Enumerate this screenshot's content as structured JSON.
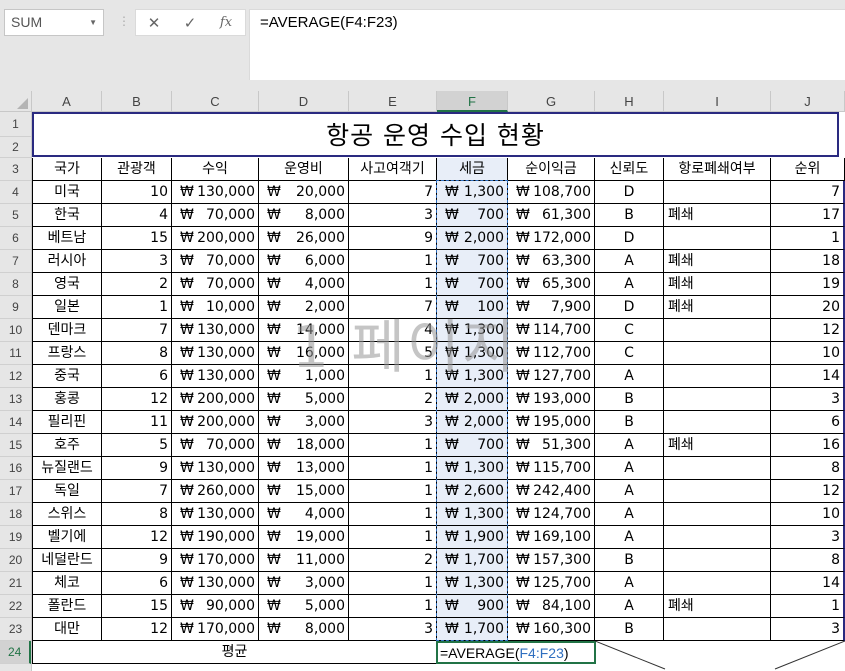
{
  "name_box": "SUM",
  "formula_bar": {
    "cancel_icon": "close-icon",
    "enter_icon": "checkmark-icon",
    "fx_label": "fx",
    "formula": "=AVERAGE(F4:F23)"
  },
  "columns": [
    "A",
    "B",
    "C",
    "D",
    "E",
    "F",
    "G",
    "H",
    "I",
    "J"
  ],
  "rows": [
    "1",
    "2",
    "3",
    "4",
    "5",
    "6",
    "7",
    "8",
    "9",
    "10",
    "11",
    "12",
    "13",
    "14",
    "15",
    "16",
    "17",
    "18",
    "19",
    "20",
    "21",
    "22",
    "23",
    "24"
  ],
  "title": "항공 운영 수입 현황",
  "headers": [
    "국가",
    "관광객",
    "수익",
    "운영비",
    "사고여객기",
    "세금",
    "순이익금",
    "신뢰도",
    "항로폐쇄여부",
    "순위"
  ],
  "currency_symbol": "₩",
  "table": [
    [
      "미국",
      "10",
      "130,000",
      "20,000",
      "7",
      "1,300",
      "108,700",
      "D",
      "",
      "7"
    ],
    [
      "한국",
      "4",
      "70,000",
      "8,000",
      "3",
      "700",
      "61,300",
      "B",
      "폐쇄",
      "17"
    ],
    [
      "베트남",
      "15",
      "200,000",
      "26,000",
      "9",
      "2,000",
      "172,000",
      "D",
      "",
      "1"
    ],
    [
      "러시아",
      "3",
      "70,000",
      "6,000",
      "1",
      "700",
      "63,300",
      "A",
      "폐쇄",
      "18"
    ],
    [
      "영국",
      "2",
      "70,000",
      "4,000",
      "1",
      "700",
      "65,300",
      "A",
      "폐쇄",
      "19"
    ],
    [
      "일본",
      "1",
      "10,000",
      "2,000",
      "7",
      "100",
      "7,900",
      "D",
      "폐쇄",
      "20"
    ],
    [
      "덴마크",
      "7",
      "130,000",
      "14,000",
      "4",
      "1,300",
      "114,700",
      "C",
      "",
      "12"
    ],
    [
      "프랑스",
      "8",
      "130,000",
      "16,000",
      "5",
      "1,300",
      "112,700",
      "C",
      "",
      "10"
    ],
    [
      "중국",
      "6",
      "130,000",
      "1,000",
      "1",
      "1,300",
      "127,700",
      "A",
      "",
      "14"
    ],
    [
      "홍콩",
      "12",
      "200,000",
      "5,000",
      "2",
      "2,000",
      "193,000",
      "B",
      "",
      "3"
    ],
    [
      "필리핀",
      "11",
      "200,000",
      "3,000",
      "3",
      "2,000",
      "195,000",
      "B",
      "",
      "6"
    ],
    [
      "호주",
      "5",
      "70,000",
      "18,000",
      "1",
      "700",
      "51,300",
      "A",
      "폐쇄",
      "16"
    ],
    [
      "뉴질랜드",
      "9",
      "130,000",
      "13,000",
      "1",
      "1,300",
      "115,700",
      "A",
      "",
      "8"
    ],
    [
      "독일",
      "7",
      "260,000",
      "15,000",
      "1",
      "2,600",
      "242,400",
      "A",
      "",
      "12"
    ],
    [
      "스위스",
      "8",
      "130,000",
      "4,000",
      "1",
      "1,300",
      "124,700",
      "A",
      "",
      "10"
    ],
    [
      "벨기에",
      "12",
      "190,000",
      "19,000",
      "1",
      "1,900",
      "169,100",
      "A",
      "",
      "3"
    ],
    [
      "네덜란드",
      "9",
      "170,000",
      "11,000",
      "2",
      "1,700",
      "157,300",
      "B",
      "",
      "8"
    ],
    [
      "체코",
      "6",
      "130,000",
      "3,000",
      "1",
      "1,300",
      "125,700",
      "A",
      "",
      "14"
    ],
    [
      "폴란드",
      "15",
      "90,000",
      "5,000",
      "1",
      "900",
      "84,100",
      "A",
      "폐쇄",
      "1"
    ],
    [
      "대만",
      "12",
      "170,000",
      "8,000",
      "3",
      "1,700",
      "160,300",
      "B",
      "",
      "3"
    ]
  ],
  "summary": {
    "label": "평균",
    "edit_prefix": "=AVERAGE(",
    "edit_ref": "F4:F23",
    "edit_suffix": ")"
  },
  "watermark": "1 페이지",
  "colors": {
    "accent": "#217346",
    "selection": "#2f6fc0",
    "title_border": "#2a2a80"
  }
}
